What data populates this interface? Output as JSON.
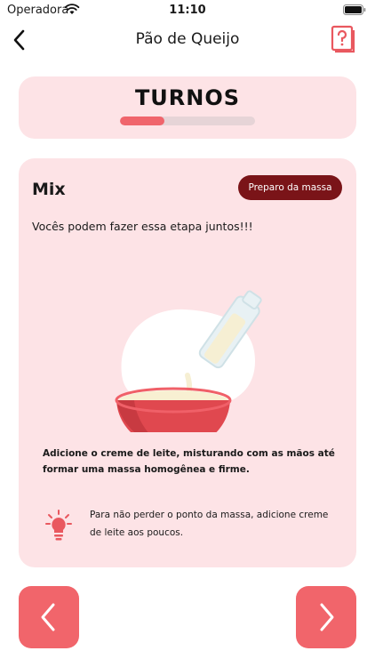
{
  "status_bar": {
    "carrier": "Operadora",
    "time": "11:10"
  },
  "nav": {
    "title": "Pão de Queijo"
  },
  "turns": {
    "title": "TURNOS",
    "progress": 0.33
  },
  "step": {
    "title": "Mix",
    "stage_label": "Preparo da massa",
    "subtitle": "Vocês podem fazer essa etapa juntos!!!",
    "instruction": "Adicione o creme de leite, misturando com as mãos até formar uma massa homogênea e firme.",
    "tip": "Para não perder o ponto da massa, adicione creme de leite aos poucos."
  },
  "colors": {
    "accent": "#f1656b",
    "card_bg": "#fde3e6",
    "stage_button_bg": "#7a1418"
  },
  "icons": {
    "back": "chevron-left-icon",
    "help": "question-card-icon",
    "tip": "lightbulb-icon",
    "prev": "chevron-left-icon",
    "next": "chevron-right-icon"
  }
}
